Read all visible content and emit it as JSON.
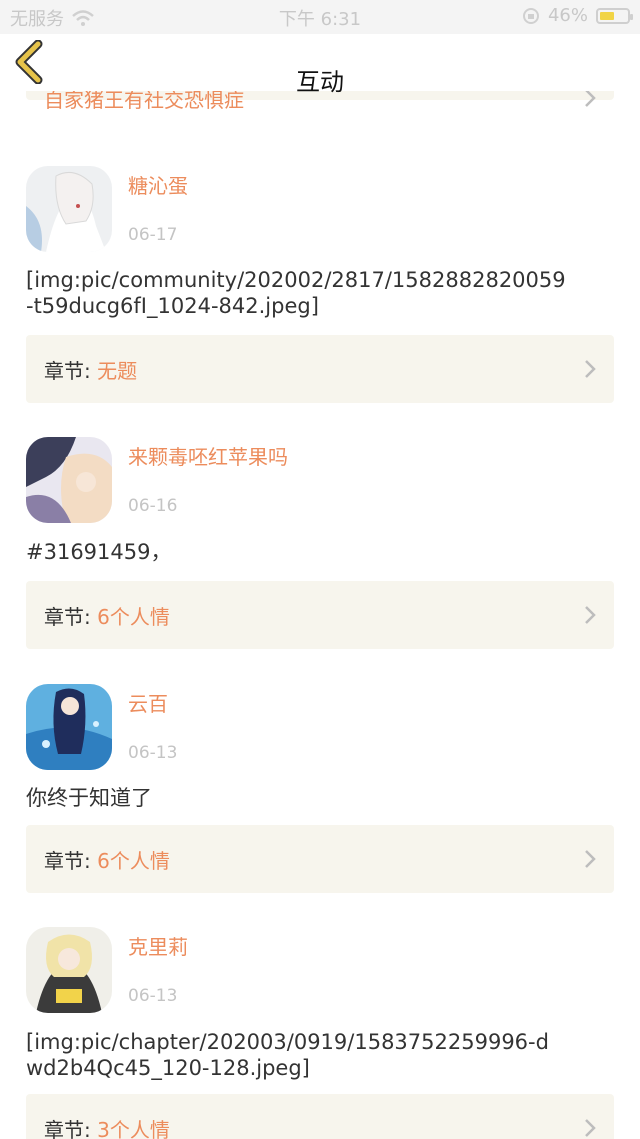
{
  "status_bar": {
    "carrier": "无服务",
    "time": "下午 6:31",
    "battery": "46%",
    "battery_level": 0.46
  },
  "navbar": {
    "title": "互动",
    "back_icon": "chevron-left-icon"
  },
  "top_partial_card": {
    "text": "自家猪王有社交恐惧症"
  },
  "chapter_prefix": "章节:",
  "posts": [
    {
      "username": "糖沁蛋",
      "date": "06-17",
      "comment": "[img:pic/community/202002/2817/1582882820059-t59ducg6fI_1024-842.jpeg]",
      "chapter": "无题"
    },
    {
      "username": "来颗毒呸红苹果吗",
      "date": "06-16",
      "comment": "#31691459，",
      "chapter": "6个人情"
    },
    {
      "username": "云百",
      "date": "06-13",
      "comment": "你终于知道了",
      "chapter": "6个人情"
    },
    {
      "username": "克里莉",
      "date": "06-13",
      "comment": "[img:pic/chapter/202003/0919/1583752259996-dwd2b4Qc45_120-128.jpeg]",
      "chapter": "3个人情"
    }
  ],
  "colors": {
    "accent": "#ec8c5c",
    "card_bg": "#f7f5ed",
    "back_icon": "#e6c34a"
  }
}
